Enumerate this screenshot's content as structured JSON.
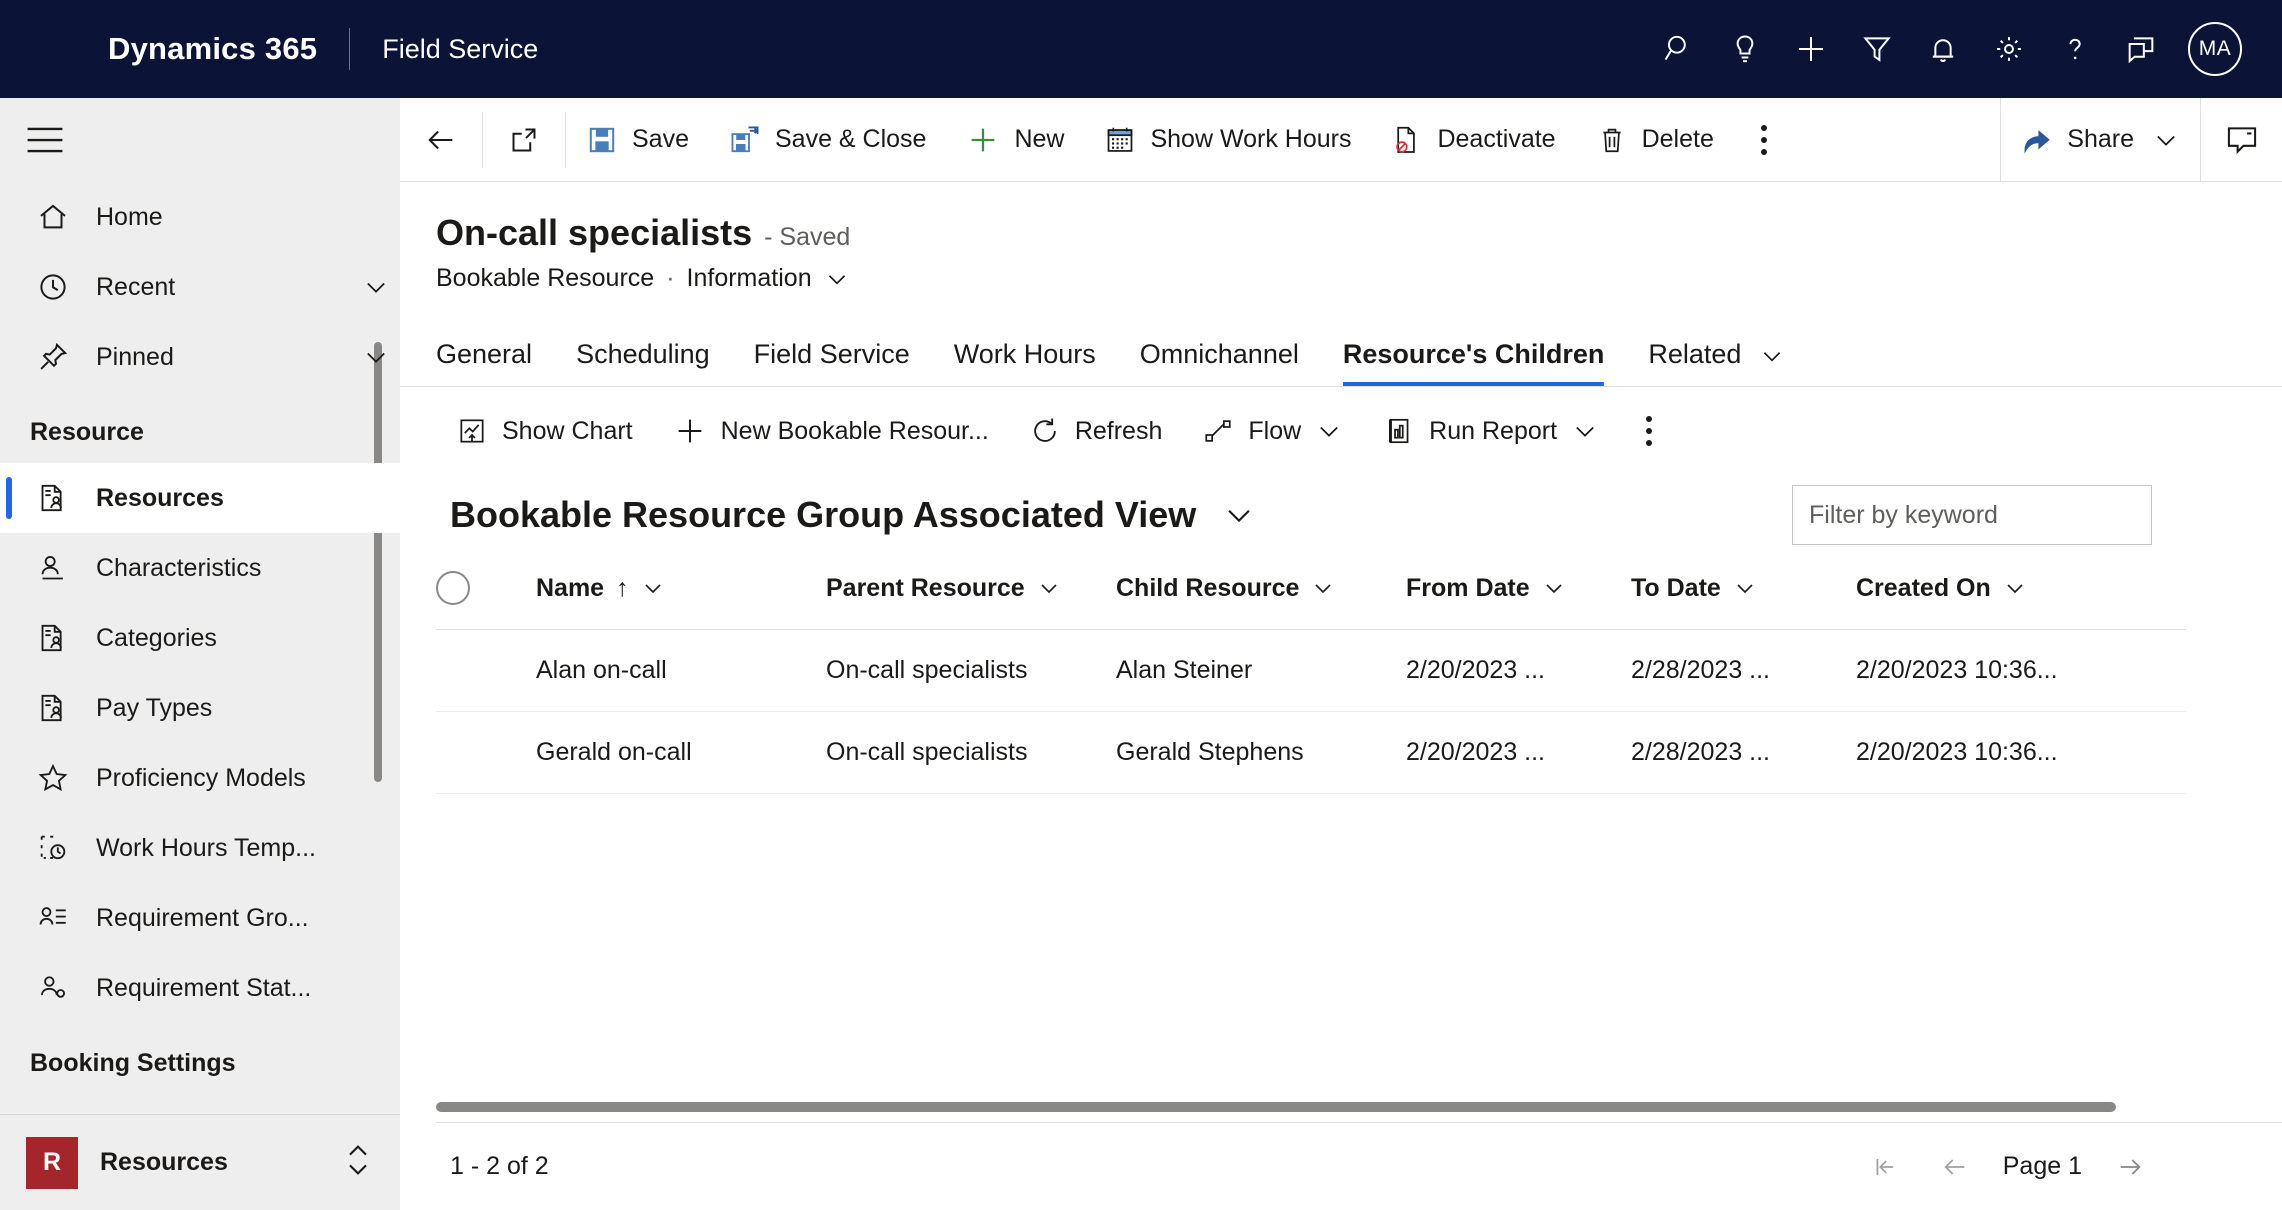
{
  "topbar": {
    "brand": "Dynamics 365",
    "app_name": "Field Service",
    "icons": [
      {
        "name": "search-icon",
        "label": "Search"
      },
      {
        "name": "lightbulb-icon",
        "label": "Insights"
      },
      {
        "name": "plus-icon",
        "label": "Quick create"
      },
      {
        "name": "filter-icon",
        "label": "Filter"
      },
      {
        "name": "bell-icon",
        "label": "Notifications"
      },
      {
        "name": "gear-icon",
        "label": "Settings"
      },
      {
        "name": "question-icon",
        "label": "Help"
      },
      {
        "name": "feedback-icon",
        "label": "Feedback"
      }
    ],
    "avatar_initials": "MA"
  },
  "sidebar": {
    "top_items": [
      {
        "label": "Home",
        "icon": "home-icon",
        "chevron": false
      },
      {
        "label": "Recent",
        "icon": "clock-icon",
        "chevron": true
      },
      {
        "label": "Pinned",
        "icon": "pin-icon",
        "chevron": true
      }
    ],
    "group_title": "Resource",
    "items": [
      {
        "label": "Resources",
        "icon": "resource-icon",
        "selected": true
      },
      {
        "label": "Characteristics",
        "icon": "person-line-icon",
        "selected": false
      },
      {
        "label": "Categories",
        "icon": "resource-icon",
        "selected": false
      },
      {
        "label": "Pay Types",
        "icon": "resource-icon",
        "selected": false
      },
      {
        "label": "Proficiency Models",
        "icon": "star-icon",
        "selected": false
      },
      {
        "label": "Work Hours Temp...",
        "icon": "work-hours-icon",
        "selected": false
      },
      {
        "label": "Requirement Gro...",
        "icon": "person-list-icon",
        "selected": false
      },
      {
        "label": "Requirement Stat...",
        "icon": "person-gear-icon",
        "selected": false
      }
    ],
    "group_title_2": "Booking Settings",
    "footer": {
      "badge": "R",
      "label": "Resources",
      "switcher_icon": "chevron-updown-icon"
    }
  },
  "commandbar": {
    "back_icon": "back-arrow-icon",
    "popout_icon": "open-in-new-icon",
    "buttons": [
      {
        "label": "Save",
        "icon": "save-icon"
      },
      {
        "label": "Save & Close",
        "icon": "save-close-icon"
      },
      {
        "label": "New",
        "icon": "plus-icon"
      },
      {
        "label": "Show Work Hours",
        "icon": "calendar-icon"
      },
      {
        "label": "Deactivate",
        "icon": "deactivate-icon"
      },
      {
        "label": "Delete",
        "icon": "trash-icon"
      }
    ],
    "overflow_icon": "more-vertical-icon",
    "share": {
      "label": "Share",
      "icon": "share-icon",
      "chevron": "chevron-down-icon"
    },
    "rail_icon": "side-pane-icon"
  },
  "record": {
    "title": "On-call specialists",
    "status": "- Saved",
    "entity": "Bookable Resource",
    "separator": "·",
    "form": "Information"
  },
  "form_tabs": [
    {
      "label": "General",
      "active": false,
      "chevron": false
    },
    {
      "label": "Scheduling",
      "active": false,
      "chevron": false
    },
    {
      "label": "Field Service",
      "active": false,
      "chevron": false
    },
    {
      "label": "Work Hours",
      "active": false,
      "chevron": false
    },
    {
      "label": "Omnichannel",
      "active": false,
      "chevron": false
    },
    {
      "label": "Resource's Children",
      "active": true,
      "chevron": false
    },
    {
      "label": "Related",
      "active": false,
      "chevron": true
    }
  ],
  "subgrid": {
    "commands": [
      {
        "label": "Show Chart",
        "icon": "show-chart-icon",
        "chevron": false
      },
      {
        "label": "New Bookable Resour...",
        "icon": "plus-icon",
        "chevron": false
      },
      {
        "label": "Refresh",
        "icon": "refresh-icon",
        "chevron": false
      },
      {
        "label": "Flow",
        "icon": "flow-icon",
        "chevron": true
      },
      {
        "label": "Run Report",
        "icon": "report-icon",
        "chevron": true
      }
    ],
    "overflow_icon": "more-vertical-icon",
    "view_title": "Bookable Resource Group Associated View",
    "view_chevron": "chevron-down-icon",
    "filter": {
      "placeholder": "Filter by keyword",
      "value": ""
    },
    "columns": [
      {
        "label": "Name",
        "sort": "↑",
        "chevron": true
      },
      {
        "label": "Parent Resource",
        "sort": "",
        "chevron": true
      },
      {
        "label": "Child Resource",
        "sort": "",
        "chevron": true
      },
      {
        "label": "From Date",
        "sort": "",
        "chevron": true
      },
      {
        "label": "To Date",
        "sort": "",
        "chevron": true
      },
      {
        "label": "Created On",
        "sort": "",
        "chevron": true
      }
    ],
    "rows": [
      {
        "name": "Alan on-call",
        "parent_resource": "On-call specialists",
        "child_resource": "Alan Steiner",
        "from_date": "2/20/2023 ...",
        "to_date": "2/28/2023 ...",
        "created_on": "2/20/2023 10:36..."
      },
      {
        "name": "Gerald on-call",
        "parent_resource": "On-call specialists",
        "child_resource": "Gerald Stephens",
        "from_date": "2/20/2023 ...",
        "to_date": "2/28/2023 ...",
        "created_on": "2/20/2023 10:36..."
      }
    ],
    "footer": {
      "count": "1 - 2 of 2",
      "page_label": "Page 1",
      "first_icon": "page-first-icon",
      "prev_icon": "page-prev-icon",
      "next_icon": "page-next-icon"
    }
  },
  "colors": {
    "topbar_bg": "#0b1437",
    "accent": "#2266e3",
    "link": "#2266e3",
    "sidebar_bg": "#eeeeee",
    "badge_bg": "#a4262c",
    "save_icon": "#4a7ebb",
    "new_green": "#3c8c40",
    "deactivate_red": "#d13438"
  }
}
